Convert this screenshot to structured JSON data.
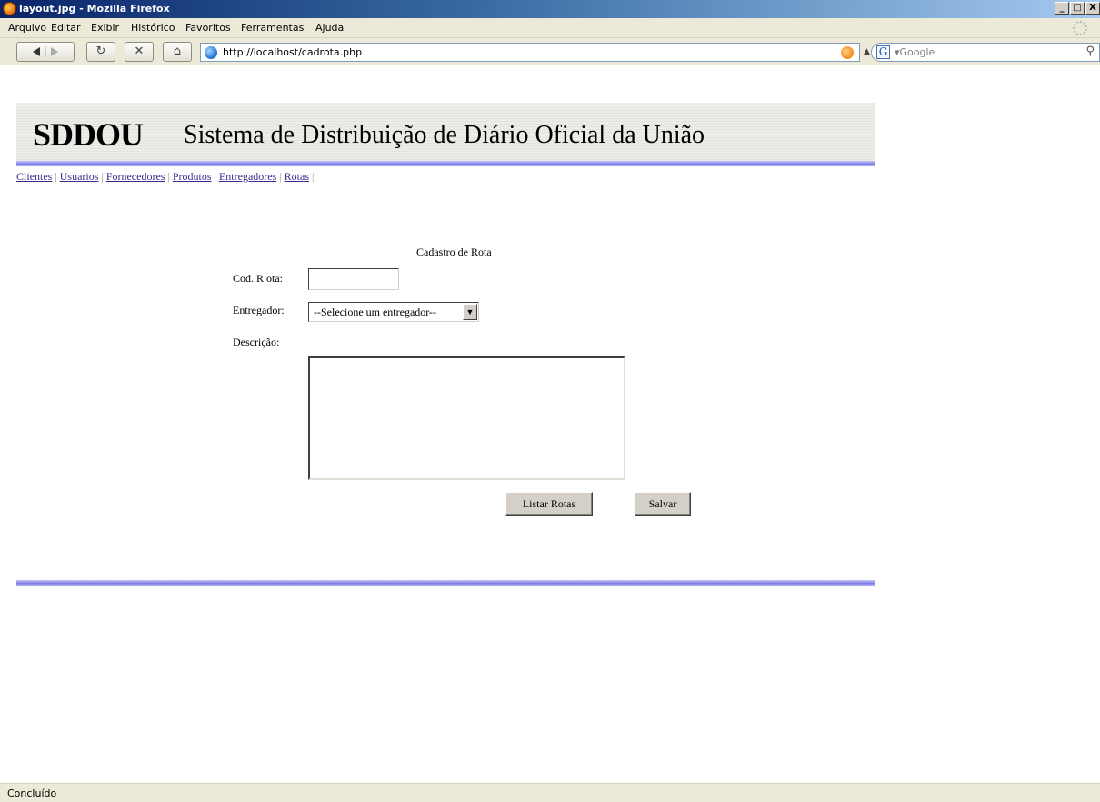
{
  "window": {
    "title": "layout.jpg - Mozilla Firefox",
    "controls": [
      "_",
      "□",
      "X"
    ]
  },
  "menu": [
    "Arquivo",
    "Editar",
    "Exibir",
    "Histórico",
    "Favoritos",
    "Ferramentas",
    "Ajuda"
  ],
  "toolbar": {
    "back_icon": "back-arrow-icon",
    "reload_label": "↻",
    "stop_label": "✕",
    "home_label": "⌂",
    "url": "http://localhost/cadrota.php",
    "search_engine_letter": "G",
    "search_placeholder": "▾Google",
    "search_icon": "⚲"
  },
  "banner": {
    "acronym": "SDDOU",
    "system_name": "Sistema de Distribuição de Diário Oficial da União"
  },
  "nav_links": [
    "Clientes",
    "Usuarios",
    "Fornecedores",
    "Produtos",
    "Entregadores",
    "Rotas"
  ],
  "nav_separator": "|",
  "form": {
    "title": "Cadastro de Rota",
    "cod_label": "Cod. R ota:",
    "cod_value": "",
    "entregador_label": "Entregador:",
    "entregador_selected": "--Selecione um entregador--",
    "descricao_label": "Descrição:",
    "descricao_value": "",
    "listar_button": "Listar Rotas",
    "salvar_button": "Salvar"
  },
  "status": "Concluído",
  "colors": {
    "titlebar_start": "#0a246a",
    "chrome_bg": "#ece9d8",
    "rule_color": "#7a7ae6",
    "link_color": "#3b2b8f"
  }
}
